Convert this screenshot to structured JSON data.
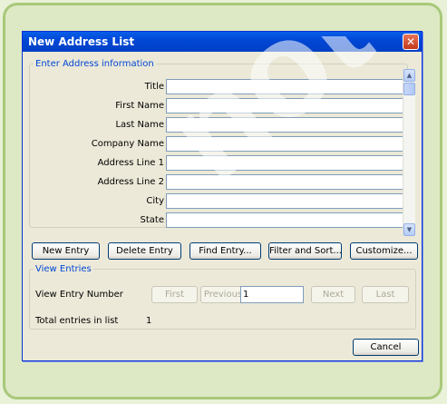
{
  "dialog": {
    "title": "New Address List",
    "address_group": "Enter Address information",
    "fields": [
      {
        "label": "Title",
        "value": ""
      },
      {
        "label": "First Name",
        "value": ""
      },
      {
        "label": "Last Name",
        "value": ""
      },
      {
        "label": "Company Name",
        "value": ""
      },
      {
        "label": "Address Line 1",
        "value": ""
      },
      {
        "label": "Address Line 2",
        "value": ""
      },
      {
        "label": "City",
        "value": ""
      },
      {
        "label": "State",
        "value": ""
      }
    ],
    "buttons": {
      "new_entry": "New Entry",
      "delete_entry": "Delete Entry",
      "find_entry": "Find Entry...",
      "filter_sort": "Filter and Sort...",
      "customize": "Customize..."
    },
    "view": {
      "group_label": "View Entries",
      "entry_number_label": "View Entry Number",
      "first": "First",
      "previous": "Previous",
      "entry_number": "1",
      "next": "Next",
      "last": "Last",
      "total_label": "Total entries in list",
      "total_value": "1"
    },
    "cancel": "Cancel"
  },
  "watermark": "not",
  "icons": {
    "close": "close-icon",
    "scroll_up": "arrow-up-icon",
    "scroll_down": "arrow-down-icon"
  },
  "colors": {
    "titlebar": "#0046d5",
    "frame": "#a8c97a",
    "background": "#dde9c4"
  }
}
